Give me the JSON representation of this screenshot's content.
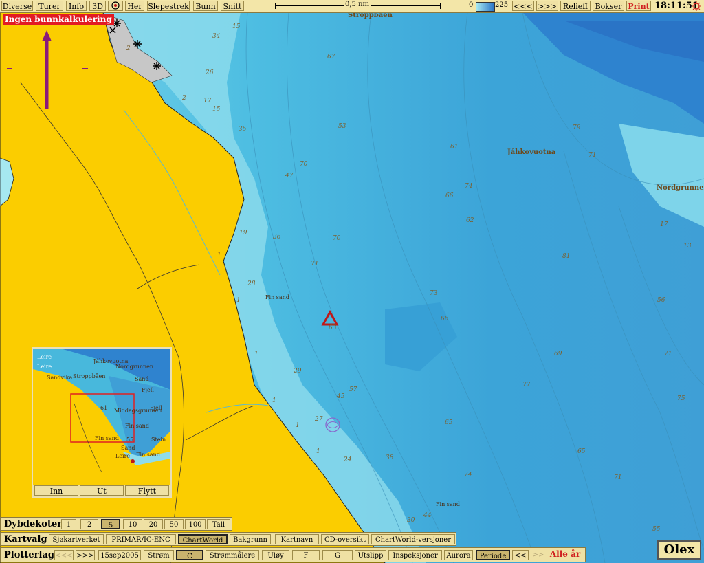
{
  "toolbar": {
    "diverse": "Diverse",
    "turer": "Turer",
    "info": "Info",
    "three_d": "3D",
    "her": "Her",
    "slepestrek": "Slepestrek",
    "bunn": "Bunn",
    "snitt": "Snitt",
    "scale_label": "0,5 nm",
    "depth_min": "0",
    "depth_max": "225",
    "prev": "<<<",
    "next": ">>>",
    "relieff": "Relieff",
    "bokser": "Bokser",
    "print": "Print",
    "clock": "18:11:51"
  },
  "warning": "Ingen bunnkalkulering",
  "place_names": {
    "stroppbaen": "Stroppbåen",
    "jahkovuotna": "Jáhkovuotna",
    "nordgrunnen": "Nordgrunnen"
  },
  "seabed_labels": [
    "Fin sand",
    "Fin sand"
  ],
  "depths": [
    "15",
    "2",
    "34",
    "26",
    "2",
    "17",
    "15",
    "67",
    "53",
    "61",
    "35",
    "47",
    "70",
    "66",
    "74",
    "62",
    "70",
    "19",
    "36",
    "71",
    "28",
    "1",
    "73",
    "66",
    "1",
    "29",
    "57",
    "45",
    "27",
    "65",
    "1",
    "24",
    "38",
    "74",
    "1",
    "30",
    "44",
    "55",
    "77",
    "71",
    "69",
    "81",
    "79",
    "56",
    "71",
    "75",
    "65",
    "71",
    "17",
    "13",
    "1",
    "1",
    "63"
  ],
  "inset": {
    "labels": [
      "Leire",
      "Leire",
      "Sandvika",
      "Stroppbåen",
      "Jáhkovuotna",
      "Nordgrunnen",
      "Sand",
      "Fjell",
      "Fjell",
      "Middagsgrunnen",
      "Fin sand",
      "Fin sand",
      "Stein",
      "Sand",
      "Leire",
      "Fin sand",
      "61",
      "55"
    ],
    "buttons": {
      "inn": "Inn",
      "ut": "Ut",
      "flytt": "Flytt"
    }
  },
  "dybdekoter": {
    "label": "Dybdekoter",
    "options": [
      "1",
      "2",
      "5",
      "10",
      "20",
      "50",
      "100",
      "Tall"
    ],
    "selected": "5"
  },
  "kartvalg": {
    "label": "Kartvalg",
    "options": [
      "Sjøkartverket",
      "PRIMAR/IC-ENC",
      "ChartWorld",
      "Bakgrunn",
      "Kartnavn",
      "CD-oversikt",
      "ChartWorld-versjoner"
    ],
    "selected": "ChartWorld"
  },
  "plotterlag": {
    "label": "Plotterlag",
    "prev": "<<<",
    "next": ">>>",
    "date": "15sep2005",
    "strom": "Strøm",
    "c": "C",
    "strommalere": "Strømmålere",
    "uloy": "Uløy",
    "f": "F",
    "g": "G",
    "utslipp": "Utslipp",
    "inspeksjoner": "Inspeksjoner",
    "aurora": "Aurora",
    "periode": "Periode",
    "back": "<<",
    "fwd": ">>",
    "alle_ar": "Alle år"
  },
  "logo": "Olex",
  "colors": {
    "land": "#fbcd00",
    "shallow": "#a6e8f0",
    "mid": "#48b8dc",
    "deep": "#2f8ad0",
    "warning_bg": "#e21b23",
    "toolbar_bg": "#f3e6a8"
  }
}
